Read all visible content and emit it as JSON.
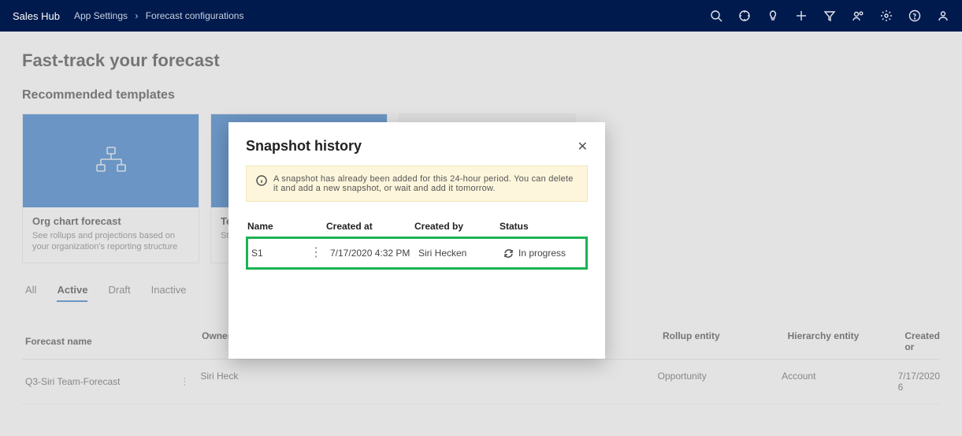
{
  "topbar": {
    "app_name": "Sales Hub",
    "crumb1": "App Settings",
    "crumb2": "Forecast configurations"
  },
  "page": {
    "title": "Fast-track your forecast",
    "section": "Recommended templates"
  },
  "cards": [
    {
      "title": "Org chart forecast",
      "desc": "See rollups and projections based on your organization's reporting structure"
    },
    {
      "title": "Te",
      "desc": "Str\npro"
    }
  ],
  "tabs": [
    "All",
    "Active",
    "Draft",
    "Inactive"
  ],
  "active_tab_index": 1,
  "forecast_table": {
    "headers": {
      "name": "Forecast name",
      "owner": "Owner",
      "rollup": "Rollup entity",
      "hier": "Hierarchy entity",
      "created": "Created or"
    },
    "rows": [
      {
        "name": "Q3-Siri Team-Forecast",
        "owner": "Siri Heck",
        "rollup": "Opportunity",
        "hier": "Account",
        "created": "7/17/2020 6"
      }
    ]
  },
  "modal": {
    "title": "Snapshot history",
    "info": "A snapshot has already been added for this 24-hour period. You can delete it and add a new snapshot, or wait and add it tomorrow.",
    "headers": {
      "name": "Name",
      "created_at": "Created at",
      "created_by": "Created by",
      "status": "Status"
    },
    "rows": [
      {
        "name": "S1",
        "created_at": "7/17/2020 4:32 PM",
        "created_by": "Siri Hecken",
        "status": "In progress"
      }
    ]
  }
}
